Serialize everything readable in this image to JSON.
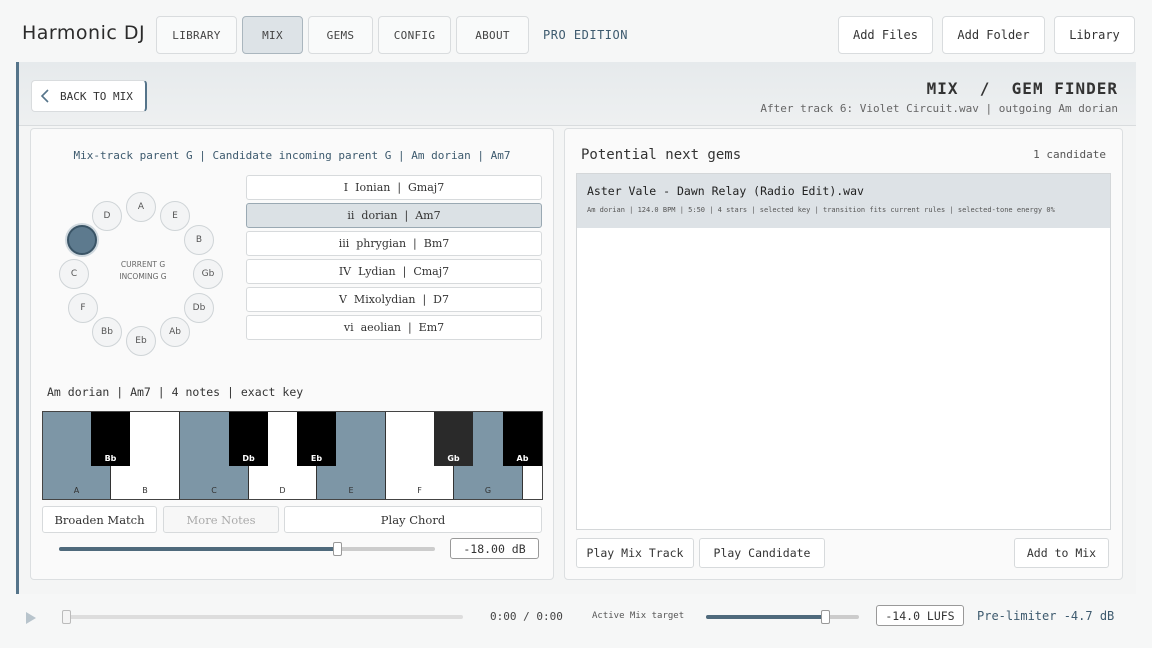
{
  "app": {
    "title": "Harmonic DJ",
    "edition": "PRO EDITION"
  },
  "nav": [
    "LIBRARY",
    "MIX",
    "GEMS",
    "CONFIG",
    "ABOUT"
  ],
  "actions": [
    "Add Files",
    "Add Folder",
    "Library"
  ],
  "header": {
    "back_label": "BACK TO MIX",
    "title": "MIX  /  GEM FINDER",
    "subtitle": "After track 6: Violet Circuit.wav | outgoing Am dorian"
  },
  "left": {
    "parent_line": "Mix-track parent G | Candidate incoming parent G | Am dorian | Am7",
    "wheel": {
      "keys": [
        "A",
        "E",
        "B",
        "Gb",
        "Db",
        "Ab",
        "Eb",
        "Bb",
        "F",
        "C",
        "G",
        "D"
      ],
      "selected": "G",
      "center_line1": "CURRENT G",
      "center_line2": "INCOMING G"
    },
    "modes": [
      "I  Ionian  |  Gmaj7",
      "ii  dorian  |  Am7",
      "iii  phrygian  |  Bm7",
      "IV  Lydian  |  Cmaj7",
      "V  Mixolydian  |  D7",
      "vi  aeolian  |  Em7"
    ],
    "active_mode_index": 1,
    "scale_info": "Am dorian | Am7 | 4 notes | exact key",
    "keyboard": {
      "white_keys": [
        {
          "note": "A",
          "on": true
        },
        {
          "note": "B",
          "on": false
        },
        {
          "note": "C",
          "on": true
        },
        {
          "note": "D",
          "on": false
        },
        {
          "note": "E",
          "on": true
        },
        {
          "note": "F",
          "on": false
        },
        {
          "note": "G",
          "on": true
        }
      ],
      "black_keys": [
        "Bb",
        "Db",
        "Eb",
        "Gb",
        "Ab"
      ]
    },
    "buttons": {
      "broaden": "Broaden Match",
      "more_notes": "More Notes",
      "play_chord": "Play Chord"
    },
    "volume": {
      "level": 0.74,
      "value": "-18.00 dB"
    }
  },
  "right": {
    "title": "Potential next gems",
    "count": "1 candidate",
    "gems": [
      {
        "name": "Aster Vale - Dawn Relay (Radio Edit).wav",
        "meta": "Am dorian | 124.0 BPM | 5:50 | 4 stars | selected key | transition fits current rules | selected-tone energy 0%"
      }
    ],
    "buttons": {
      "play_mix": "Play Mix Track",
      "play_candidate": "Play Candidate",
      "add_to_mix": "Add to Mix"
    }
  },
  "transport": {
    "progress": 0.0,
    "time": "0:00 / 0:00",
    "target_label": "Active Mix target",
    "target_level": 0.78,
    "target_value": "-14.0 LUFS",
    "prelimiter": "Pre-limiter -4.7 dB"
  }
}
